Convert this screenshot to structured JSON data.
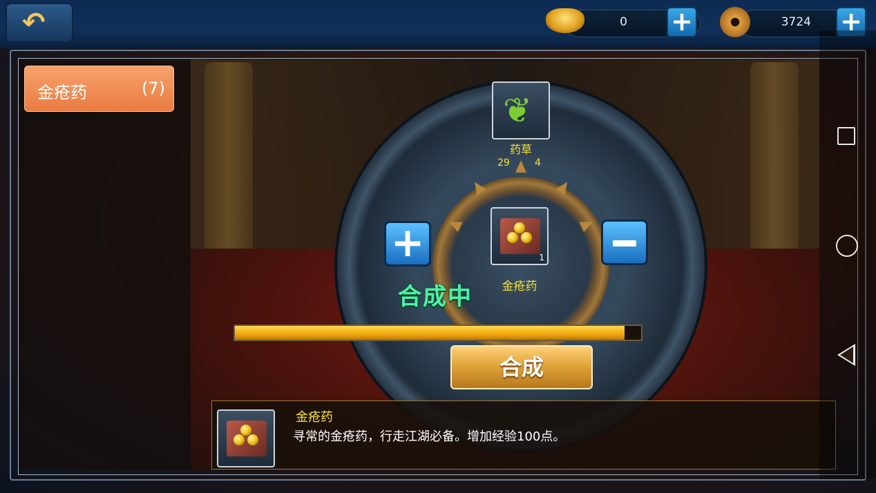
{
  "topbar": {
    "back_icon": "back-arrow-icon",
    "ingot": {
      "icon": "gold-ingot-icon",
      "value": "0",
      "add_label": "+"
    },
    "coin": {
      "icon": "copper-coin-icon",
      "value": "3724",
      "add_label": "+"
    }
  },
  "sidebar": {
    "items": [
      {
        "name": "金疮药",
        "count": "(7)",
        "selected": true
      }
    ]
  },
  "synthesis": {
    "material": {
      "icon": "herb-icon",
      "name": "药草",
      "have": "29",
      "need": "4"
    },
    "product": {
      "icon": "golden-pill-icon",
      "name": "金疮药",
      "quantity": "1"
    },
    "increase_label": "+",
    "decrease_label": "−",
    "status": "合成中",
    "progress": 0.96,
    "craft_label": "合成"
  },
  "info": {
    "name": "金疮药",
    "description": "寻常的金疮药，行走江湖必备。增加经验100点。"
  },
  "colors": {
    "accent_orange": "#e97c42",
    "status_green": "#4cf2a4",
    "label_yellow": "#f6e23a",
    "button_blue": "#1a6fc0",
    "progress_gold": "#f0a810"
  }
}
